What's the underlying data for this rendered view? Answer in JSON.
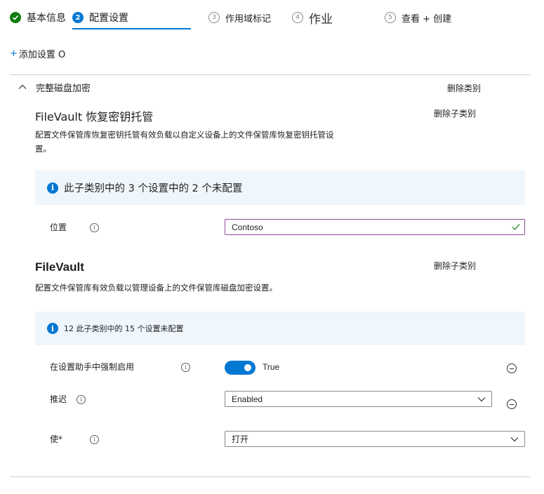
{
  "steps": [
    {
      "number": "✓",
      "label": "基本信息",
      "state": "completed"
    },
    {
      "number": "2",
      "label": "配置设置",
      "state": "current"
    },
    {
      "number": "3",
      "label": "作用域标记",
      "state": "pending"
    },
    {
      "number": "4",
      "label": "作业",
      "state": "pending"
    },
    {
      "number": "5",
      "label": "查看 + 创建",
      "state": "pending"
    }
  ],
  "add_setting": {
    "label": "添加设置 O",
    "icon": "plus-icon"
  },
  "section": {
    "title": "完整磁盘加密",
    "delete_label": "删除类别",
    "expanded": true,
    "icon": "chevron-up-icon"
  },
  "subcategory1": {
    "title": "FileVault 恢复密钥托管",
    "delete_label": "删除子类别",
    "description": "配置文件保管库恢复密钥托管有效负载以自定义设备上的文件保管库恢复密钥托管设置。",
    "info": "此子类别中的 3 个设置中的 2 个未配置",
    "settings": {
      "location": {
        "label": "位置",
        "value": "Contoso",
        "valid": true
      }
    }
  },
  "subcategory2": {
    "title": "FileVault",
    "delete_label": "删除子类别",
    "description": "配置文件保管库有效负载以管理设备上的文件保管库磁盘加密设置。",
    "info": "12 此子类别中的 15 个设置未配置",
    "settings": {
      "force_enable": {
        "label": "在设置助手中强制启用",
        "toggle_on": true,
        "value": "True"
      },
      "defer": {
        "label": "推迟",
        "value": "Enabled"
      },
      "enable": {
        "label": "使*",
        "value": "打开"
      }
    }
  },
  "colors": {
    "accent": "#0078d4",
    "success": "#107c10",
    "info_background": "#eff6fc",
    "valid_border": "#8f4a9a"
  }
}
